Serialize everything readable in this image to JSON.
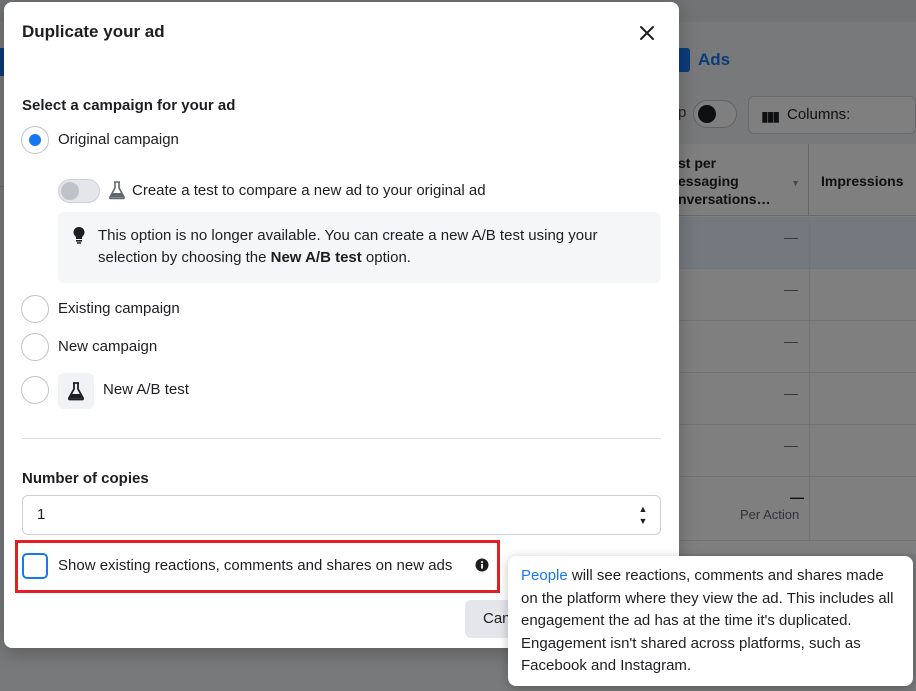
{
  "background": {
    "ads_label": "Ads",
    "columns_label": "Columns:",
    "partial_text": "p",
    "table": {
      "col1_header": "st per\nessaging\nnversations…",
      "col2_header": "Impressions",
      "rows": [
        "—",
        "—",
        "—",
        "—",
        "—"
      ],
      "summary_value": "—",
      "summary_caption": "Per Action"
    }
  },
  "modal": {
    "title": "Duplicate your ad",
    "campaign_section_label": "Select a campaign for your ad",
    "options": {
      "original": "Original campaign",
      "existing": "Existing campaign",
      "new": "New campaign",
      "ab_test": "New A/B test"
    },
    "selected_option": "original",
    "test_toggle_label": "Create a test to compare a new ad to your original ad",
    "info": {
      "text_before": "This option is no longer available. You can create a new A/B test using your selection by choosing the ",
      "bold": "New A/B test",
      "text_after": " option."
    },
    "copies_label": "Number of copies",
    "copies_value": "1",
    "show_reactions_label": "Show existing reactions, comments and shares on new ads",
    "cancel_label": "Can"
  },
  "tooltip": {
    "link": "People",
    "text": " will see reactions, comments and shares made on the platform where they view the ad. This includes all engagement the ad has at the time it's duplicated. Engagement isn't shared across platforms, such as Facebook and Instagram."
  },
  "colors": {
    "accent": "#1877f2",
    "highlight": "#e41e26"
  }
}
